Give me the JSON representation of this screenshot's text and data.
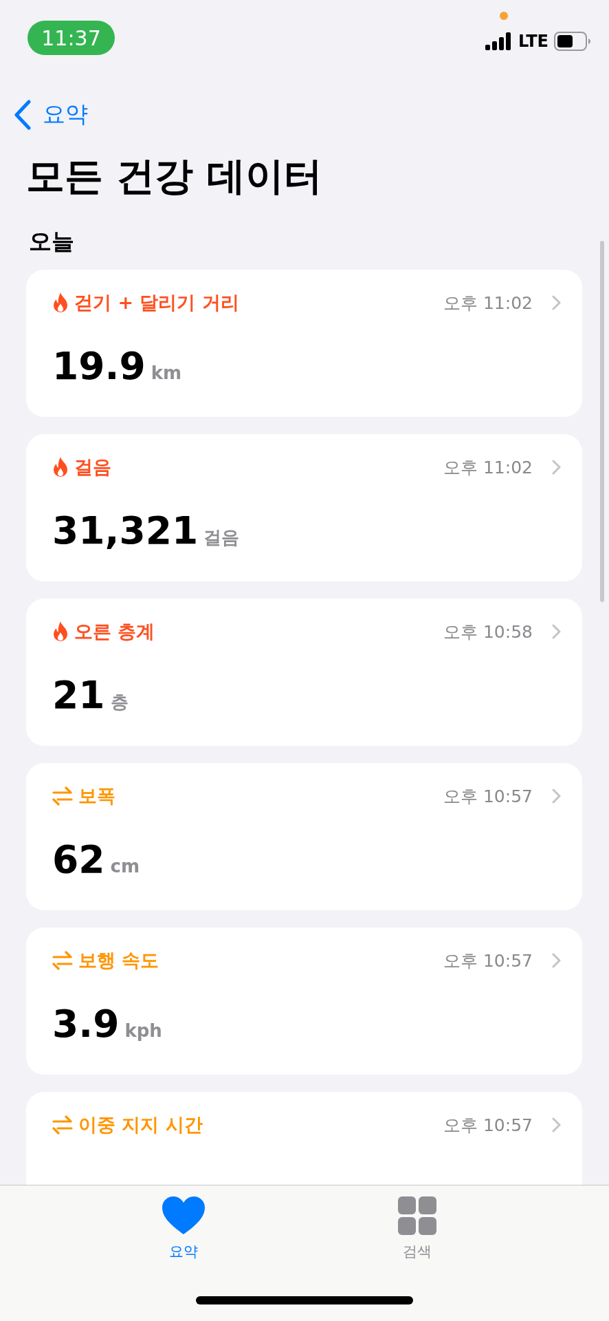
{
  "status_bar": {
    "time": "11:37",
    "network": "LTE"
  },
  "nav": {
    "back_label": "요약",
    "title": "모든 건강 데이터"
  },
  "section": {
    "title": "오늘"
  },
  "cards": [
    {
      "kind": "activity",
      "label": "걷기 + 달리기 거리",
      "time": "오후 11:02",
      "value": "19.9",
      "unit": "km"
    },
    {
      "kind": "activity",
      "label": "걸음",
      "time": "오후 11:02",
      "value": "31,321",
      "unit": "걸음"
    },
    {
      "kind": "activity",
      "label": "오른 층계",
      "time": "오후 10:58",
      "value": "21",
      "unit": "층"
    },
    {
      "kind": "mobility",
      "label": "보폭",
      "time": "오후 10:57",
      "value": "62",
      "unit": "cm"
    },
    {
      "kind": "mobility",
      "label": "보행 속도",
      "time": "오후 10:57",
      "value": "3.9",
      "unit": "kph"
    },
    {
      "kind": "mobility",
      "label": "이중 지지 시간",
      "time": "오후 10:57"
    }
  ],
  "tab_bar": [
    {
      "kind": "summary",
      "label": "요약",
      "selected": true
    },
    {
      "kind": "browse",
      "label": "검색",
      "selected": false
    }
  ]
}
